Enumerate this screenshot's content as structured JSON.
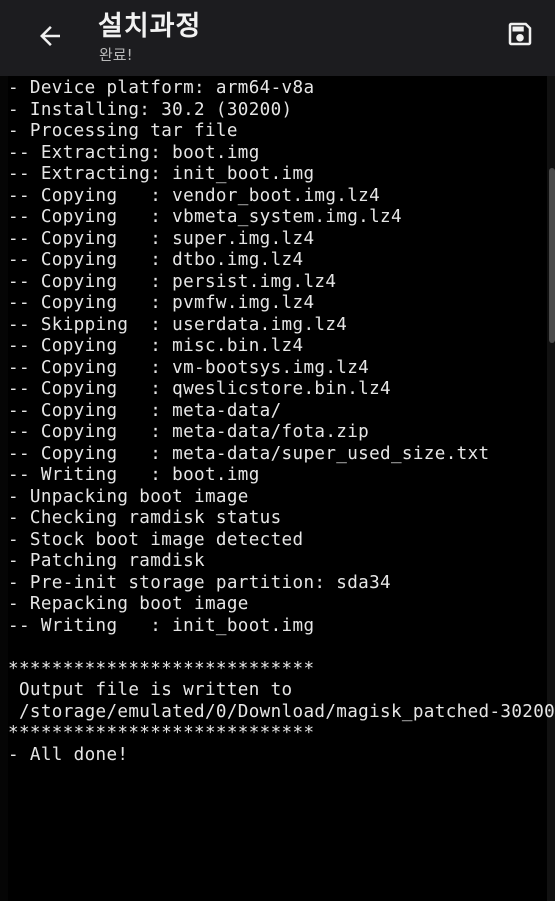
{
  "app_bar": {
    "back_icon": "arrow-back-icon",
    "title": "설치과정",
    "subtitle": "완료!",
    "save_icon": "save-icon"
  },
  "log": {
    "lines": [
      "- Device platform: arm64-v8a",
      "- Installing: 30.2 (30200)",
      "- Processing tar file",
      "-- Extracting: boot.img",
      "-- Extracting: init_boot.img",
      "-- Copying   : vendor_boot.img.lz4",
      "-- Copying   : vbmeta_system.img.lz4",
      "-- Copying   : super.img.lz4",
      "-- Copying   : dtbo.img.lz4",
      "-- Copying   : persist.img.lz4",
      "-- Copying   : pvmfw.img.lz4",
      "-- Skipping  : userdata.img.lz4",
      "-- Copying   : misc.bin.lz4",
      "-- Copying   : vm-bootsys.img.lz4",
      "-- Copying   : qweslicstore.bin.lz4",
      "-- Copying   : meta-data/",
      "-- Copying   : meta-data/fota.zip",
      "-- Copying   : meta-data/super_used_size.txt",
      "-- Writing   : boot.img",
      "- Unpacking boot image",
      "- Checking ramdisk status",
      "- Stock boot image detected",
      "- Patching ramdisk",
      "- Pre-init storage partition: sda34",
      "- Repacking boot image",
      "-- Writing   : init_boot.img",
      "",
      "****************************",
      " Output file is written to",
      " /storage/emulated/0/Download/magisk_patched-30200",
      "****************************",
      "- All done!"
    ]
  }
}
